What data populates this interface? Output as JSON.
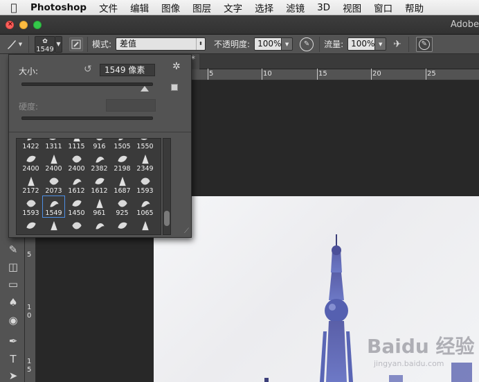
{
  "menubar": {
    "app": "Photoshop",
    "items": [
      "文件",
      "编辑",
      "图像",
      "图层",
      "文字",
      "选择",
      "滤镜",
      "3D",
      "视图",
      "窗口",
      "帮助"
    ]
  },
  "window": {
    "title": "Adobe"
  },
  "options": {
    "brush_size": "1549",
    "mode_label": "模式:",
    "mode_value": "差值",
    "opacity_label": "不透明度:",
    "opacity_value": "100%",
    "flow_label": "流量:",
    "flow_value": "100%"
  },
  "doc": {
    "tab_close": "*"
  },
  "ruler_h": [
    "5",
    "10",
    "15",
    "20",
    "25"
  ],
  "ruler_v": [
    "5",
    "1",
    "0",
    "1",
    "5"
  ],
  "brush_panel": {
    "size_label": "大小:",
    "size_value": "1549 像素",
    "hardness_label": "硬度:",
    "size_slider": 0.94,
    "presets_rows": [
      [
        "1422",
        "1311",
        "1115",
        "916",
        "1505",
        "1550"
      ],
      [
        "2400",
        "2400",
        "2400",
        "2382",
        "2198",
        "2349"
      ],
      [
        "2172",
        "2073",
        "1612",
        "1612",
        "1687",
        "1593"
      ],
      [
        "1593",
        "1549",
        "1450",
        "961",
        "925",
        "1065"
      ]
    ],
    "selected_preset": "1549"
  },
  "watermark": {
    "text": "Baidu 经验",
    "sub": "jingyan.baidu.com"
  },
  "colors": {
    "accent": "#4d8fe6",
    "panel": "#535353",
    "menubar": "#ebebeb"
  }
}
